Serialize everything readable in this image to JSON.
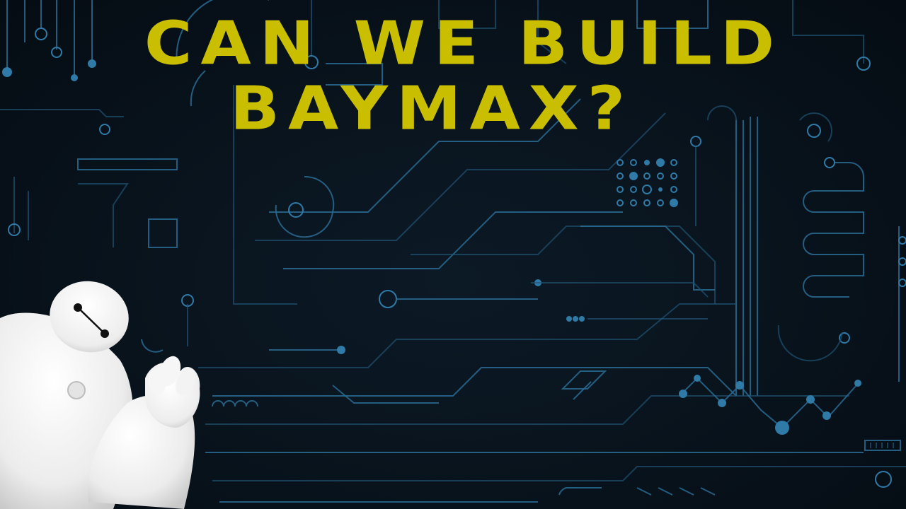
{
  "title": {
    "line1": "CAN WE BUILD",
    "line2": "BAYMAX?"
  },
  "colors": {
    "background": "#07111a",
    "circuit": "#2a6b93",
    "title": "#c9bf00",
    "robot": "#f4f4f4"
  },
  "icons": {
    "background": "circuit-board-pattern",
    "character": "baymax-robot"
  }
}
